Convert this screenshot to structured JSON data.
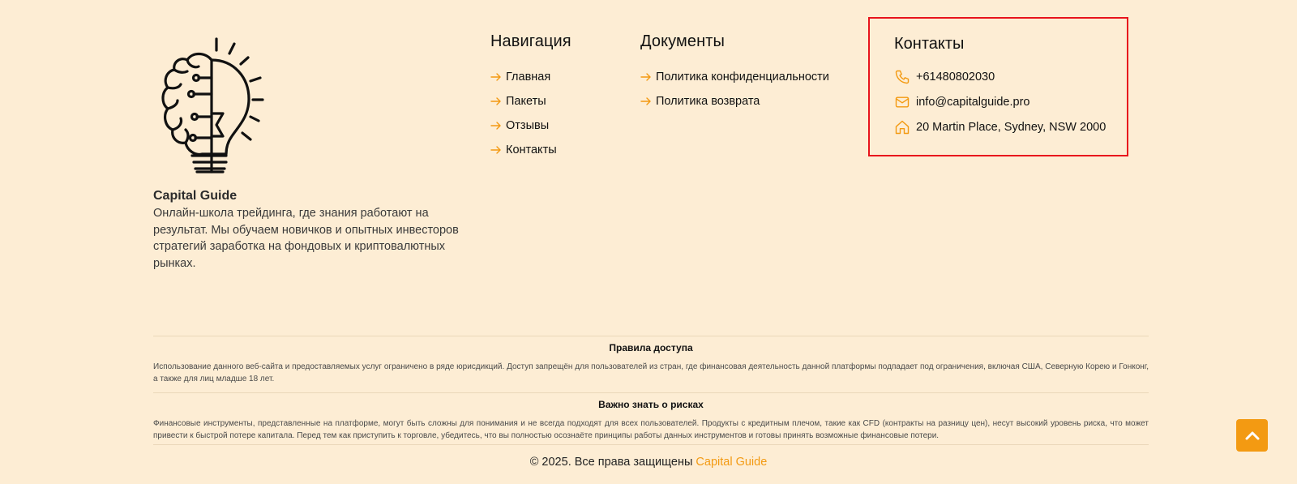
{
  "brand": {
    "name": "Capital Guide",
    "description": "Онлайн-школа трейдинга, где знания работают на результат. Мы обучаем новичков и опытных инвесторов стратегий заработка на фондовых и криптовалютных рынках.",
    "logo_icon": "brain-lightbulb-icon"
  },
  "navigation": {
    "title": "Навигация",
    "items": [
      "Главная",
      "Пакеты",
      "Отзывы",
      "Контакты"
    ]
  },
  "documents": {
    "title": "Документы",
    "items": [
      "Политика конфиденциальности",
      "Политика возврата"
    ]
  },
  "contacts": {
    "title": "Контакты",
    "phone": "+61480802030",
    "email": "info@capitalguide.pro",
    "address": "20 Martin Place, Sydney, NSW 2000"
  },
  "access_rules": {
    "title": "Правила доступа",
    "text": "Использование данного веб-сайта и предоставляемых услуг ограничено в ряде юрисдикций. Доступ запрещён для пользователей из стран, где финансовая деятельность данной платформы подпадает под ограничения, включая США, Северную Корею и Гонконг, а также для лиц младше 18 лет."
  },
  "risks": {
    "title": "Важно знать о рисках",
    "text": "Финансовые инструменты, представленные на платформе, могут быть сложны для понимания и не всегда подходят для всех пользователей. Продукты с кредитным плечом, такие как CFD (контракты на разницу цен), несут высокий уровень риска, что может привести к быстрой потере капитала. Перед тем как приступить к торговле, убедитесь, что вы полностью осознаёте принципы работы данных инструментов и готовы принять возможные финансовые потери."
  },
  "copyright": {
    "text": "© 2025. Все права защищены",
    "brand": "Capital Guide"
  },
  "colors": {
    "background": "#fdedd4",
    "accent": "#f39a12",
    "highlight_border": "#e8141c"
  },
  "icons": {
    "link_arrow": "arrow-right-icon",
    "phone": "phone-icon",
    "email": "mail-icon",
    "address": "home-icon",
    "scroll_top": "chevron-up-icon"
  }
}
